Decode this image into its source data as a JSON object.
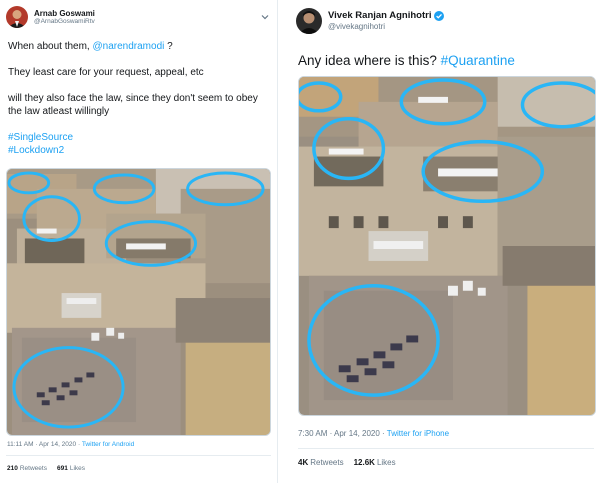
{
  "left_tweet": {
    "author": {
      "name": "Arnab Goswami",
      "handle": "@ArnabGoswamiRtv"
    },
    "text": {
      "line1_prefix": "When about them, ",
      "line1_mention": "@narendramodi",
      "line1_suffix": " ?",
      "line2": "They least care for your request, appeal, etc",
      "line3": "will they also face the law, since they don't seem to obey the law atleast willingly",
      "hashtag1": "#SingleSource",
      "hashtag2": "#Lockdown2"
    },
    "timestamp": "11:11 AM · Apr 14, 2020 ·",
    "source": "Twitter for Android",
    "stats": {
      "retweets_count": "210",
      "retweets_label": "Retweets",
      "likes_count": "691",
      "likes_label": "Likes"
    }
  },
  "right_tweet": {
    "author": {
      "name": "Vivek Ranjan Agnihotri",
      "handle": "@vivekagnihotri",
      "verified": true
    },
    "text": {
      "body": "Any idea where is this? ",
      "hashtag": "#Quarantine"
    },
    "timestamp": "7:30 AM · Apr 14, 2020 ·",
    "source": "Twitter for iPhone",
    "stats": {
      "retweets_count": "4K",
      "retweets_label": "Retweets",
      "likes_count": "12.6K",
      "likes_label": "Likes"
    }
  },
  "colors": {
    "link": "#1da1f2",
    "text": "#14171a",
    "muted": "#657786",
    "annotation": "#29b6f6",
    "building": "#b9a58a",
    "roof": "#c7c2b8"
  },
  "icons": [
    "avatar",
    "verified-icon",
    "chevron-down-icon"
  ]
}
